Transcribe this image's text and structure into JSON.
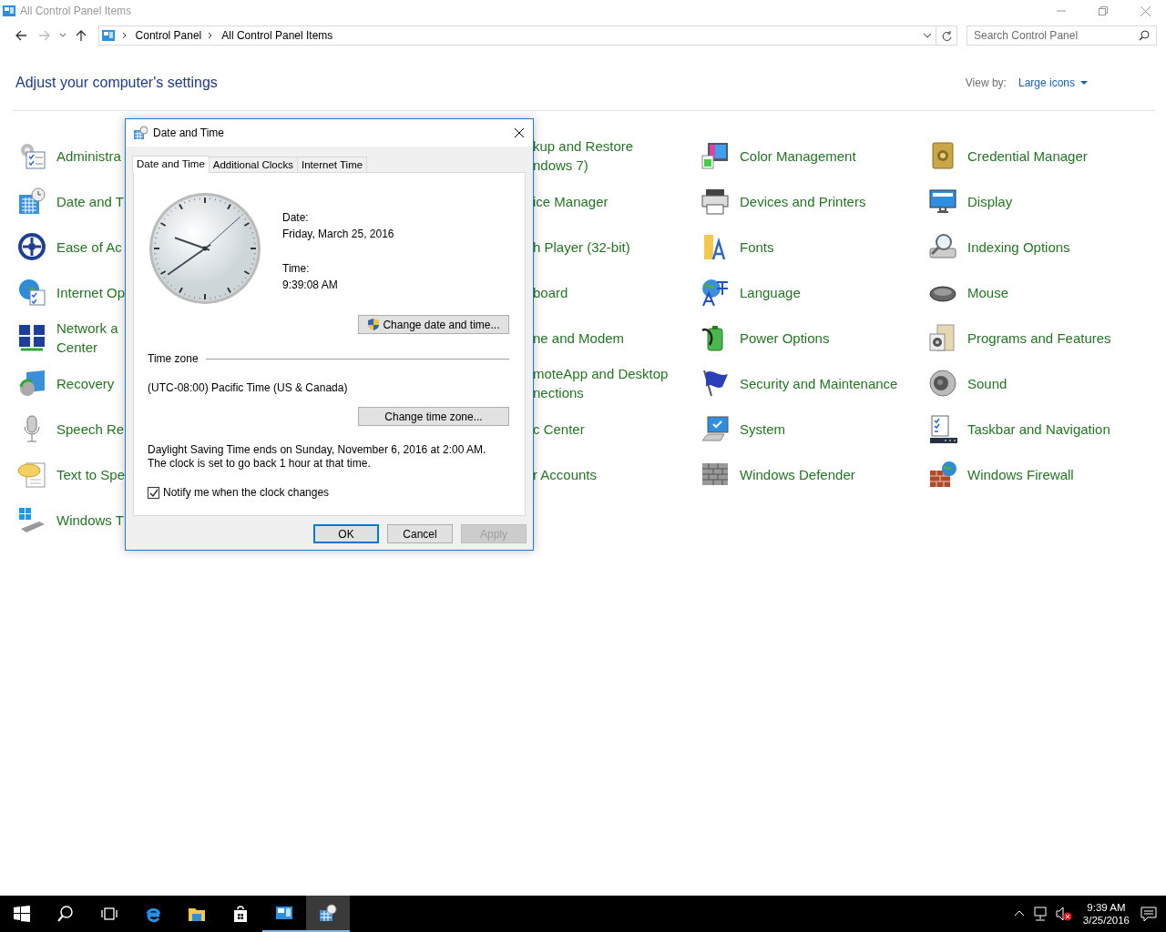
{
  "window": {
    "title": "All Control Panel Items"
  },
  "address_bar": {
    "path": [
      "Control Panel",
      "All Control Panel Items"
    ]
  },
  "search": {
    "placeholder": "Search Control Panel"
  },
  "heading": "Adjust your computer's settings",
  "view_by": {
    "label": "View by:",
    "value": "Large icons"
  },
  "columns": [
    {
      "items": [
        {
          "lines": [
            "Administra"
          ]
        },
        {
          "lines": [
            "Date and T"
          ]
        },
        {
          "lines": [
            "Ease of Ac"
          ]
        },
        {
          "lines": [
            "Internet Op"
          ]
        },
        {
          "lines": [
            "Network a",
            "Center"
          ]
        },
        {
          "lines": [
            "Recovery"
          ]
        },
        {
          "lines": [
            "Speech Re"
          ]
        },
        {
          "lines": [
            "Text to Spe"
          ]
        },
        {
          "lines": [
            "Windows T"
          ]
        }
      ]
    },
    {
      "items": [
        {
          "lines": [
            "kup and Restore",
            "ndows 7)"
          ]
        },
        {
          "lines": [
            "ice Manager"
          ]
        },
        {
          "lines": [
            "h Player (32-bit)"
          ]
        },
        {
          "lines": [
            "board"
          ]
        },
        {
          "lines": [
            "ne and Modem"
          ]
        },
        {
          "lines": [
            "moteApp and Desktop",
            "nections"
          ]
        },
        {
          "lines": [
            "c Center"
          ]
        },
        {
          "lines": [
            "r Accounts"
          ]
        }
      ]
    },
    {
      "items": [
        {
          "lines": [
            "Color Management"
          ]
        },
        {
          "lines": [
            "Devices and Printers"
          ]
        },
        {
          "lines": [
            "Fonts"
          ]
        },
        {
          "lines": [
            "Language"
          ]
        },
        {
          "lines": [
            "Power Options"
          ]
        },
        {
          "lines": [
            "Security and Maintenance"
          ]
        },
        {
          "lines": [
            "System"
          ]
        },
        {
          "lines": [
            "Windows Defender"
          ]
        }
      ]
    },
    {
      "items": [
        {
          "lines": [
            "Credential Manager"
          ]
        },
        {
          "lines": [
            "Display"
          ]
        },
        {
          "lines": [
            "Indexing Options"
          ]
        },
        {
          "lines": [
            "Mouse"
          ]
        },
        {
          "lines": [
            "Programs and Features"
          ]
        },
        {
          "lines": [
            "Sound"
          ]
        },
        {
          "lines": [
            "Taskbar and Navigation"
          ]
        },
        {
          "lines": [
            "Windows Firewall"
          ]
        }
      ]
    }
  ],
  "dialog": {
    "title": "Date and Time",
    "tabs": [
      {
        "label": "Date and Time",
        "selected": true
      },
      {
        "label": "Additional Clocks",
        "selected": false
      },
      {
        "label": "Internet Time",
        "selected": false
      }
    ],
    "date_label": "Date:",
    "date": "Friday, March 25, 2016",
    "time_label": "Time:",
    "time": "9:39:08 AM",
    "change_datetime_button": "Change date and time...",
    "timezone_heading": "Time zone",
    "timezone": "(UTC-08:00) Pacific Time (US & Canada)",
    "change_timezone_button": "Change time zone...",
    "dst_note": "Daylight Saving Time ends on Sunday, November 6, 2016 at 2:00 AM. The clock is set to go back 1 hour at that time.",
    "notify": {
      "label": "Notify me when the clock changes",
      "checked": true
    },
    "buttons": [
      {
        "label": "OK",
        "default": true,
        "disabled": false
      },
      {
        "label": "Cancel",
        "default": false,
        "disabled": false
      },
      {
        "label": "Apply",
        "default": false,
        "disabled": true
      }
    ]
  },
  "taskbar": {
    "apps": [
      {
        "open": false,
        "selected": false
      },
      {
        "open": false,
        "selected": false
      },
      {
        "open": false,
        "selected": false
      },
      {
        "open": false,
        "selected": false
      },
      {
        "open": false,
        "selected": false
      },
      {
        "open": false,
        "selected": false
      },
      {
        "open": true,
        "selected": false
      },
      {
        "open": true,
        "selected": true
      }
    ],
    "clock": {
      "time": "9:39 AM",
      "date": "3/25/2016"
    }
  }
}
